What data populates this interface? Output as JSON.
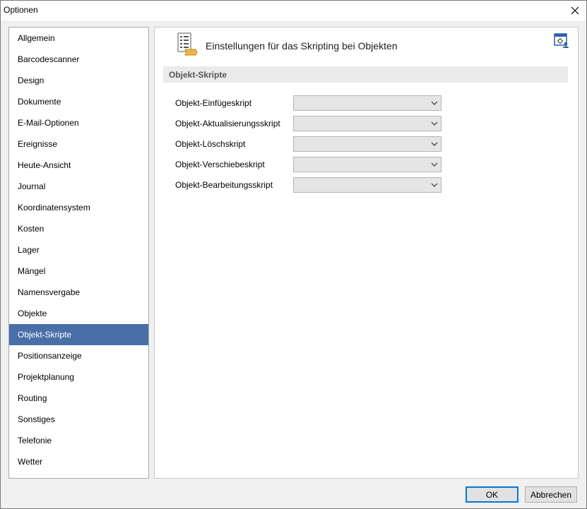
{
  "window": {
    "title": "Optionen"
  },
  "sidebar": {
    "items": [
      {
        "label": "Allgemein"
      },
      {
        "label": "Barcodescanner"
      },
      {
        "label": "Design"
      },
      {
        "label": "Dokumente"
      },
      {
        "label": "E-Mail-Optionen"
      },
      {
        "label": "Ereignisse"
      },
      {
        "label": "Heute-Ansicht"
      },
      {
        "label": "Journal"
      },
      {
        "label": "Koordinatensystem"
      },
      {
        "label": "Kosten"
      },
      {
        "label": "Lager"
      },
      {
        "label": "Mängel"
      },
      {
        "label": "Namensvergabe"
      },
      {
        "label": "Objekte"
      },
      {
        "label": "Objekt-Skripte"
      },
      {
        "label": "Positionsanzeige"
      },
      {
        "label": "Projektplanung"
      },
      {
        "label": "Routing"
      },
      {
        "label": "Sonstiges"
      },
      {
        "label": "Telefonie"
      },
      {
        "label": "Wetter"
      }
    ],
    "selected": "Objekt-Skripte"
  },
  "panel": {
    "header_title": "Einstellungen für das Skripting bei Objekten",
    "section_title": "Objekt-Skripte",
    "fields": [
      {
        "label": "Objekt-Einfügeskript",
        "value": ""
      },
      {
        "label": "Objekt-Aktualisierungsskript",
        "value": ""
      },
      {
        "label": "Objekt-Löschskript",
        "value": ""
      },
      {
        "label": "Objekt-Verschiebeskript",
        "value": ""
      },
      {
        "label": "Objekt-Bearbeitungsskript",
        "value": ""
      }
    ]
  },
  "buttons": {
    "ok": "OK",
    "cancel": "Abbrechen"
  },
  "icons": {
    "close": "close-icon",
    "header": "script-settings-icon",
    "help": "settings-user-icon",
    "dropdown": "chevron-down-icon"
  },
  "colors": {
    "selection": "#4a6fa8",
    "accent": "#0078d7"
  }
}
